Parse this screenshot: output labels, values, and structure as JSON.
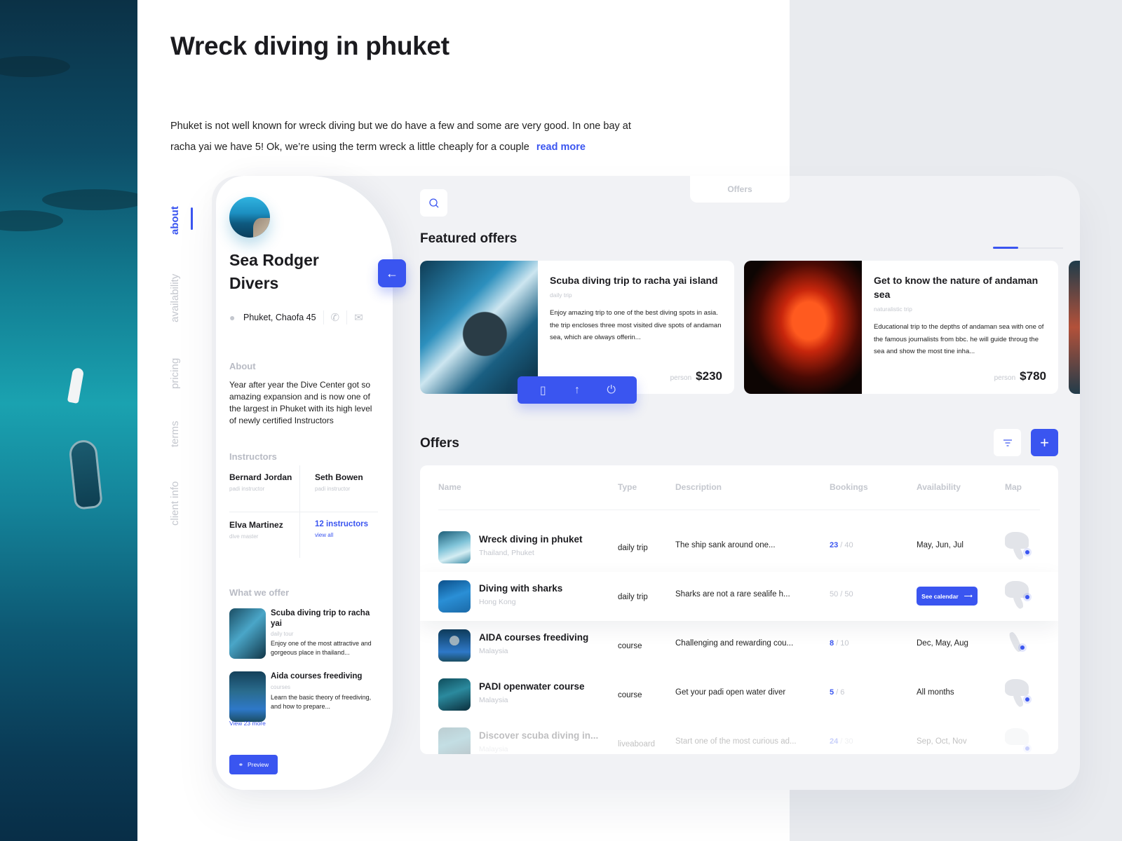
{
  "hero": {
    "title": "Wreck diving in phuket",
    "description": "Phuket is not well known for wreck diving but we do have a few and some are very good. In one bay at racha yai we have 5! Ok, we’re using the term wreck a little cheaply for a couple",
    "read_more": "read more"
  },
  "colors": {
    "accent": "#3a55f0",
    "muted": "#c4c7ce",
    "panel": "#f1f2f5"
  },
  "side_nav": {
    "items": [
      {
        "label": "about",
        "active": true
      },
      {
        "label": "availability",
        "active": false
      },
      {
        "label": "pricing",
        "active": false
      },
      {
        "label": "terms",
        "active": false
      },
      {
        "label": "client info",
        "active": false
      }
    ]
  },
  "profile": {
    "name": "Sea Rodger Divers",
    "address": "Phuket, Chaofa 45",
    "icons": {
      "location": "map-pin-icon",
      "phone": "phone-icon",
      "email": "mail-icon",
      "back": "arrow-left-icon"
    },
    "about_label": "About",
    "about_text": "Year after year the Dive Center got so amazing expansion and is now one of the largest in Phuket with its high level of newly certified Instructors",
    "instructors_label": "Instructors",
    "instructors": [
      {
        "name": "Bernard Jordan",
        "role": "padi instructor"
      },
      {
        "name": "Seth Bowen",
        "role": "padi instructor"
      },
      {
        "name": "Elva Martinez",
        "role": "dive master"
      }
    ],
    "instructors_more": {
      "count_label": "12 instructors",
      "link": "view all"
    },
    "offer_label": "What we offer",
    "offers": [
      {
        "title": "Scuba diving trip to racha yai",
        "category": "daily tour",
        "description": "Enjoy one of the most attractive and gorgeous place in thailand..."
      },
      {
        "title": "Aida courses freediving",
        "category": "courses",
        "description": "Learn the basic theory of freediving, and how to prepare..."
      }
    ],
    "view_more": "View 23 more",
    "preview_button": "Preview"
  },
  "main": {
    "tab": "Offers",
    "featured_title": "Featured offers",
    "featured": [
      {
        "title": "Scuba diving trip to racha yai island",
        "category": "daily trip",
        "description": "Enjoy amazing trip to one of the best diving spots in asia. the trip encloses three most visited dive spots of andaman sea, which are olways offerin...",
        "price_label": "person",
        "price": "$230"
      },
      {
        "title": "Get to know the nature of andaman sea",
        "category": "naturalistic trip",
        "description": "Educational trip to the depths of andaman sea with one of the famous journalists from bbc. he will guide throug the sea and show the most tine inha...",
        "price_label": "person",
        "price": "$780"
      }
    ],
    "action_bar": {
      "icons": [
        "bookmark-icon",
        "arrow-up-icon",
        "power-icon"
      ]
    },
    "offers_title": "Offers",
    "table": {
      "columns": [
        "Name",
        "Type",
        "Description",
        "Bookings",
        "Availability",
        "Map"
      ],
      "rows": [
        {
          "name": "Wreck diving in phuket",
          "location": "Thailand, Phuket",
          "type": "daily trip",
          "description": "The ship sank around one...",
          "booked": "23",
          "total": "40",
          "availability": "May, Jun, Jul"
        },
        {
          "name": "Diving with sharks",
          "location": "Hong Kong",
          "type": "daily trip",
          "description": "Sharks are not a rare sealife h...",
          "booked": "50",
          "total": "50",
          "availability": "",
          "action": "See calendar"
        },
        {
          "name": "AIDA courses freediving",
          "location": "Malaysia",
          "type": "course",
          "description": "Challenging and rewarding cou...",
          "booked": "8",
          "total": "10",
          "availability": "Dec, May, Aug"
        },
        {
          "name": "PADI openwater course",
          "location": "Malaysia",
          "type": "course",
          "description": "Get your padi open water diver",
          "booked": "5",
          "total": "6",
          "availability": "All months"
        },
        {
          "name": "Discover scuba diving in...",
          "location": "Malaysia",
          "type": "liveaboard",
          "description": "Start one of the most curious ad...",
          "booked": "24",
          "total": "30",
          "availability": "Sep, Oct, Nov"
        }
      ]
    }
  }
}
